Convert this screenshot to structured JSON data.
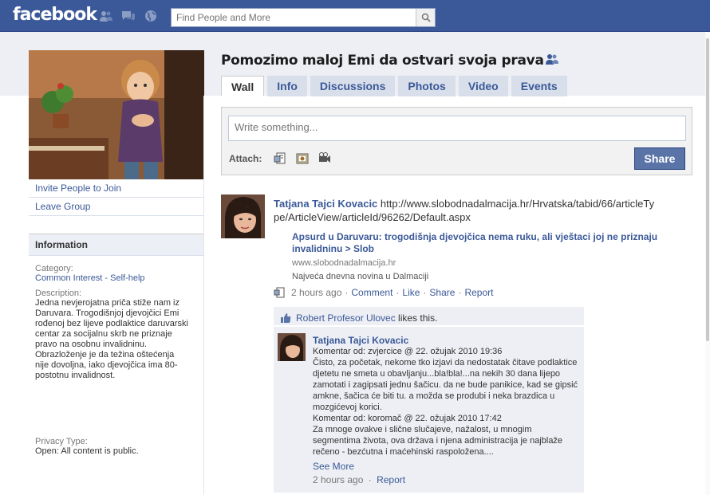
{
  "topbar": {
    "logo": "facebook",
    "search_placeholder": "Find People and More"
  },
  "group": {
    "title": "Pomozimo maloj Emi da ostvari svoja prava"
  },
  "tabs": [
    {
      "label": "Wall",
      "active": true
    },
    {
      "label": "Info",
      "active": false
    },
    {
      "label": "Discussions",
      "active": false
    },
    {
      "label": "Photos",
      "active": false
    },
    {
      "label": "Video",
      "active": false
    },
    {
      "label": "Events",
      "active": false
    }
  ],
  "sidebar": {
    "links": [
      "Invite People to Join",
      "Leave Group"
    ],
    "info_header": "Information",
    "category_label": "Category:",
    "category_value": "Common Interest - Self-help",
    "description_label": "Description:",
    "description_value": "Jedna nevjerojatna priča stiže nam iz Daruvara. Trogodišnjoj djevojčici Emi rođenoj bez lijeve podlaktice daruvarski centar za socijalnu skrb ne priznaje pravo na osobnu invalidninu. Obrazloženje je da težina oštećenja nije dovoljna, iako djevojčica ima 80-postotnu invalidnost.",
    "privacy_label": "Privacy Type:",
    "privacy_value": "Open: All content is public."
  },
  "publisher": {
    "placeholder": "Write something...",
    "attach_label": "Attach:",
    "share_label": "Share"
  },
  "story": {
    "actor": "Tatjana Tajci Kovacic",
    "message": "http://www.slobodnadalmacija.hr/Hrvatska/tabid/66/articleType/ArticleView/articleId/96262/Default.aspx",
    "attachment_title": "Apsurd u Daruvaru: trogodišnja djevojčica nema ruku, ali vještaci joj ne priznaju invalidninu > Slob",
    "attachment_caption": "www.slobodnadalmacija.hr",
    "attachment_desc": "Najveća dnevna novina u Dalmaciji",
    "time": "2 hours ago",
    "actions": [
      "Comment",
      "Like",
      "Share",
      "Report"
    ],
    "likes_text_name": "Robert Profesor Ulovec",
    "likes_text_rest": " likes this."
  },
  "comment": {
    "author": "Tatjana Tajci Kovacic",
    "body_line1": "Komentar od: zvjercice @ 22. ožujak 2010 19:36",
    "body_para1": "Čisto, za početak, nekome tko izjavi da nedostatak čitave podlaktice djetetu ne smeta u obavljanju...bla!bla!...na nekih 30 dana lijepo zamotati i zagipsati jednu šačicu. da ne bude panikice, kad se gipsić amkne, šačica će biti tu. a možda se produbi i neka brazdica u mozgićevoj korici.",
    "body_line2": "Komentar od: koromač @ 22. ožujak 2010 17:42",
    "body_para2": "Za mnoge ovakve i slične slučajeve, nažalost, u mnogim segmentima života, ova država i njena administracija je najblaže rečeno - bezćutna i maćehinski raspoložena....",
    "see_more": "See More",
    "time": "2 hours ago",
    "report": "Report"
  },
  "colors": {
    "brand": "#3b5998",
    "tab_bg": "#d8dfea",
    "comment_bg": "#edeff4"
  }
}
